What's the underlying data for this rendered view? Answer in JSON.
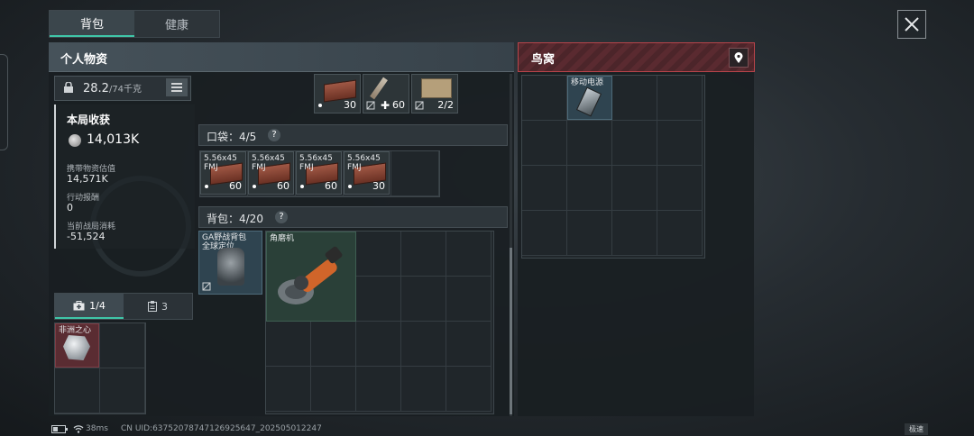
{
  "tabs": [
    {
      "label": "背包",
      "active": true
    },
    {
      "label": "健康",
      "active": false
    }
  ],
  "close_icon": "close-x-icon",
  "personal": {
    "title": "个人物资",
    "weight": {
      "value": "28.2",
      "capacity": "/74千克",
      "lock_icon": "lock-icon",
      "list_icon": "list-icon"
    },
    "stats": {
      "title": "本局收获",
      "total": "14,013K",
      "coin_icon": "coin-icon",
      "rows": [
        {
          "label": "携带物资估值",
          "value": "14,571K"
        },
        {
          "label": "行动报酬",
          "value": "0"
        },
        {
          "label": "当前战局消耗",
          "value": "-51,524"
        }
      ]
    },
    "sub_tabs": [
      {
        "label": "1/4",
        "icon": "medkit-icon",
        "active": true
      },
      {
        "label": "3",
        "icon": "clipboard-icon",
        "active": false
      }
    ],
    "secure_item": {
      "name": "非洲之心"
    }
  },
  "top_row_items": [
    {
      "name": "5.56x45 FMJ",
      "count": "30",
      "icon": "dot-icon"
    },
    {
      "name": "战地注射器",
      "count": "60",
      "icon": "plus-icon"
    },
    {
      "name": "医疗工具箱",
      "count": "2/2",
      "icon": "no-sell-icon"
    }
  ],
  "pocket": {
    "title": "口袋：4/5",
    "help": "?",
    "items": [
      {
        "name": "5.56x45 FMJ",
        "count": "60"
      },
      {
        "name": "5.56x45 FMJ",
        "count": "60"
      },
      {
        "name": "5.56x45 FMJ",
        "count": "60"
      },
      {
        "name": "5.56x45 FMJ",
        "count": "30"
      }
    ]
  },
  "backpack": {
    "title": "背包：4/20",
    "help": "?",
    "bag_item": {
      "name": "GA野战背包",
      "subname": "全球定位"
    },
    "grinder": {
      "name": "角磨机"
    }
  },
  "nest": {
    "title": "鸟窝",
    "pin_icon": "location-pin-icon",
    "item": {
      "name": "移动电源"
    }
  },
  "status": {
    "ping": "38ms",
    "uid": "CN UID:637520787471269256​47_202505012247",
    "speed": "极速"
  }
}
